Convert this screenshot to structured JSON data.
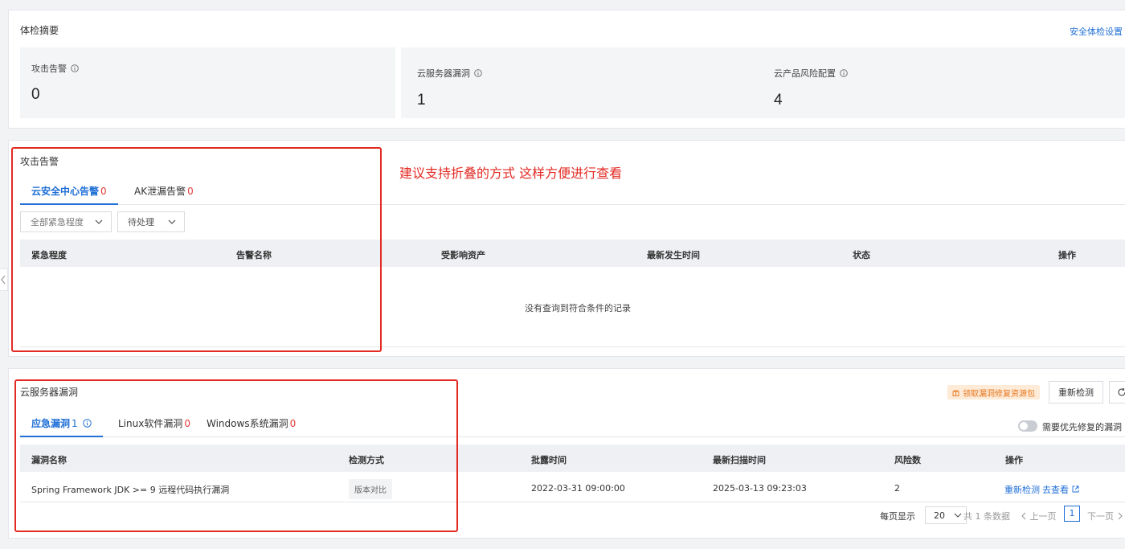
{
  "summary": {
    "title": "体检摘要",
    "settings_link": "安全体检设置",
    "metrics": [
      {
        "label": "攻击告警",
        "value": "0"
      },
      {
        "label": "云服务器漏洞",
        "value": "1"
      },
      {
        "label": "云产品风险配置",
        "value": "4"
      }
    ]
  },
  "annotation": {
    "text": "建议支持折叠的方式 这样方便进行查看",
    "color": "#e32a23"
  },
  "attack": {
    "title": "攻击告警",
    "tabs": [
      {
        "label": "云安全中心告警",
        "count": "0"
      },
      {
        "label": "AK泄漏告警",
        "count": "0"
      }
    ],
    "filters": {
      "severity": "全部紧急程度",
      "status": "待处理"
    },
    "columns": [
      "紧急程度",
      "告警名称",
      "受影响资产",
      "最新发生时间",
      "状态",
      "操作"
    ],
    "empty_text": "没有查询到符合条件的记录"
  },
  "vuln": {
    "title": "云服务器漏洞",
    "promo": "领取漏洞修复资源包",
    "recheck_button": "重新检测",
    "tabs": [
      {
        "label": "应急漏洞",
        "count": "1"
      },
      {
        "label": "Linux软件漏洞",
        "count": "0"
      },
      {
        "label": "Windows系统漏洞",
        "count": "0"
      }
    ],
    "toggle_label": "需要优先修复的漏洞",
    "columns": [
      "漏洞名称",
      "检测方式",
      "批露时间",
      "最新扫描时间",
      "风险数",
      "操作"
    ],
    "rows": [
      {
        "name": "Spring Framework JDK >= 9 远程代码执行漏洞",
        "method": "版本对比",
        "disclosed": "2022-03-31 09:00:00",
        "scanned": "2025-03-13 09:23:03",
        "risk_count": "2",
        "action_recheck": "重新检测",
        "action_view": "去查看"
      }
    ],
    "pagination": {
      "per_page_label": "每页显示",
      "per_page": "20",
      "total": "共 1 条数据",
      "prev": "上一页",
      "page": "1",
      "next": "下一页"
    }
  },
  "colors": {
    "accent": "#1f6fd6",
    "danger": "#e32a23",
    "promo_bg": "#fdebd7",
    "promo_text": "#e7761f"
  }
}
